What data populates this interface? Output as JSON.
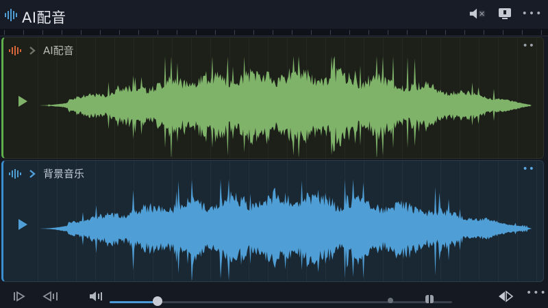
{
  "app": {
    "title": "AI配音"
  },
  "colors": {
    "voice": "#7fb36a",
    "music": "#4f9fd6",
    "accent": "#4a9ad8"
  },
  "icons": {
    "app": "waveform-icon",
    "titlebar": [
      "speaker-mute-icon",
      "display-icon",
      "more-icon"
    ],
    "bottom": [
      "skip-start-icon",
      "skip-back-icon",
      "volume-icon",
      "fullscreen-icon",
      "more-icon"
    ]
  },
  "tracks": [
    {
      "id": "voice",
      "name": "AI配音",
      "menu": "••"
    },
    {
      "id": "music",
      "name": "背景音乐",
      "menu": "••"
    }
  ],
  "playback": {
    "progress": 0.14
  },
  "bottom": {
    "more": "•••"
  },
  "titlebar": {
    "more": "•••"
  }
}
